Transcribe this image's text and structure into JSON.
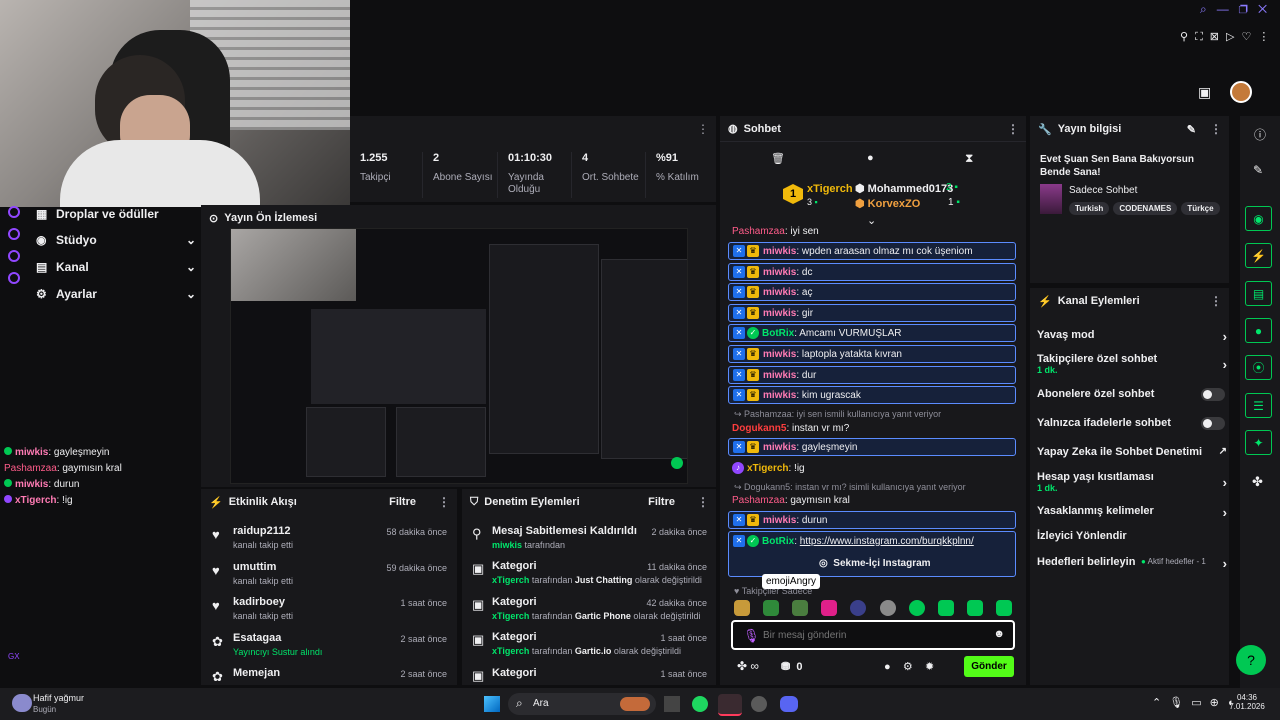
{
  "stats": [
    {
      "value": "1.255",
      "label": "Takipçi"
    },
    {
      "value": "2",
      "label": "Abone Sayısı"
    },
    {
      "value": "01:10:30",
      "label": "Yayında Olduğu"
    },
    {
      "value": "4",
      "label": "Ort. Sohbete"
    },
    {
      "value": "%91",
      "label": "% Katılım"
    }
  ],
  "nav": {
    "drops": "Droplar ve ödüller",
    "studio": "Stüdyo",
    "channel": "Kanal",
    "settings": "Ayarlar",
    "preview_title": "Yayın Ön İzlemesi"
  },
  "overlay_chat": [
    {
      "user": "miwkis",
      "text": ": gayleşmeyin"
    },
    {
      "user": "Pashamzaa",
      "text": ": gaymısın kral"
    },
    {
      "user": "miwkis",
      "text": ": durun"
    },
    {
      "user": "xTigerch",
      "text": ": !ig"
    }
  ],
  "activity": {
    "title": "Etkinlik Akışı",
    "filter": "Filtre",
    "items": [
      {
        "user": "raidup2112",
        "action": "kanalı takip etti",
        "time": "58 dakika önce"
      },
      {
        "user": "umuttim",
        "action": "kanalı takip etti",
        "time": "59 dakika önce"
      },
      {
        "user": "kadirboey",
        "action": "kanalı takip etti",
        "time": "1 saat önce"
      },
      {
        "user": "Esatagaa",
        "action": "Yayıncıyı Sustur alındı",
        "time": "2 saat önce"
      },
      {
        "user": "Memejan",
        "action": "",
        "time": "2 saat önce"
      }
    ]
  },
  "modlog": {
    "title": "Denetim Eylemleri",
    "filter": "Filtre",
    "items": [
      {
        "title": "Mesaj Sabitlemesi Kaldırıldı",
        "who": "miwkis",
        "rest": " tarafından",
        "extra": "",
        "tail": "",
        "time": "2 dakika önce"
      },
      {
        "title": "Kategori",
        "who": "xTigerch",
        "rest": " tarafından ",
        "extra": "Just Chatting",
        "tail": " olarak değiştirildi",
        "time": "11 dakika önce"
      },
      {
        "title": "Kategori",
        "who": "xTigerch",
        "rest": " tarafından ",
        "extra": "Gartic Phone",
        "tail": " olarak değiştirildi",
        "time": "42 dakika önce"
      },
      {
        "title": "Kategori",
        "who": "xTigerch",
        "rest": " tarafından ",
        "extra": "Gartic.io",
        "tail": " olarak değiştirildi",
        "time": "1 saat önce"
      },
      {
        "title": "Kategori",
        "who": "",
        "rest": "",
        "extra": "",
        "tail": "",
        "time": "1 saat önce"
      }
    ]
  },
  "chat": {
    "title": "Sohbet",
    "leaders": {
      "first_rank": "1",
      "first_name": "xTigerch",
      "first_count": "3",
      "second_name": "Mohammed0173",
      "second_count": "2",
      "third_name": "KorvexZO",
      "third_count": "1"
    },
    "messages": [
      {
        "user": "Pashamzaa",
        "text": ": iyi sen",
        "kind": "plain"
      },
      {
        "user": "miwkis",
        "text": ": wpden araasan olmaz mı cok üşeniom",
        "kind": "hl"
      },
      {
        "user": "miwkis",
        "text": ": dc",
        "kind": "hl"
      },
      {
        "user": "miwkis",
        "text": ": aç",
        "kind": "hl"
      },
      {
        "user": "miwkis",
        "text": ": gir",
        "kind": "hl"
      },
      {
        "user": "BotRix",
        "text": ": Amcamı VURMUŞLAR",
        "kind": "bot"
      },
      {
        "user": "miwkis",
        "text": ": laptopla yatakta kıvran",
        "kind": "hl"
      },
      {
        "user": "miwkis",
        "text": ": dur",
        "kind": "hl"
      },
      {
        "user": "miwkis",
        "text": ": kim ugrascak",
        "kind": "hl"
      }
    ],
    "reply1": "Pashamzaa: iyi sen ismili kullanıcıya yanıt veriyor",
    "dog_user": "Dogukann5",
    "dog_text": ": instan vr mı?",
    "msg_gay": ": gayleşmeyin",
    "xt_user": "xTigerch",
    "xt_text": ": !ig",
    "reply2": "Dogukann5: instan vr mı? isimli kullanıcıya yanıt veriyor",
    "pash_text": ": gaymısın kral",
    "durun_text": ": durun",
    "bot_link": "https://www.instagram.com/burqkkplnn/",
    "instagram_button": "Sekme-İçi Instagram",
    "tooltip": "emojiAngry",
    "followers_label": "Takipçiler Sadece",
    "placeholder": "Bir mesaj gönderin",
    "points": "0",
    "send": "Gönder"
  },
  "stream_info": {
    "title_label": "Yayın bilgisi",
    "stream_title": "Evet Şuan Sen Bana Bakıyorsun Bende Sana!",
    "category": "Sadece Sohbet",
    "tags": [
      "Turkish",
      "CODENAMES",
      "Türkçe"
    ]
  },
  "channel_actions": {
    "title": "Kanal Eylemleri",
    "slow": "Yavaş mod",
    "followers": "Takipçilere özel sohbet",
    "followers_sub": "1 dk.",
    "subs": "Abonelere özel sohbet",
    "emotes": "Yalnızca ifadelerle sohbet",
    "ai": "Yapay Zeka ile Sohbet Denetimi",
    "age": "Hesap yaşı kısıtlaması",
    "age_sub": "1 dk.",
    "banned": "Yasaklanmış kelimeler",
    "raid": "İzleyici Yönlendir",
    "goals": "Hedefleri belirleyin",
    "goals_status": "Aktif hedefler - 1"
  },
  "taskbar": {
    "weather": "Hafif yağmur",
    "weather_sub": "Bugün",
    "search": "Ara",
    "time": "04:36",
    "date": "7.01.2026",
    "gx": "GX"
  }
}
